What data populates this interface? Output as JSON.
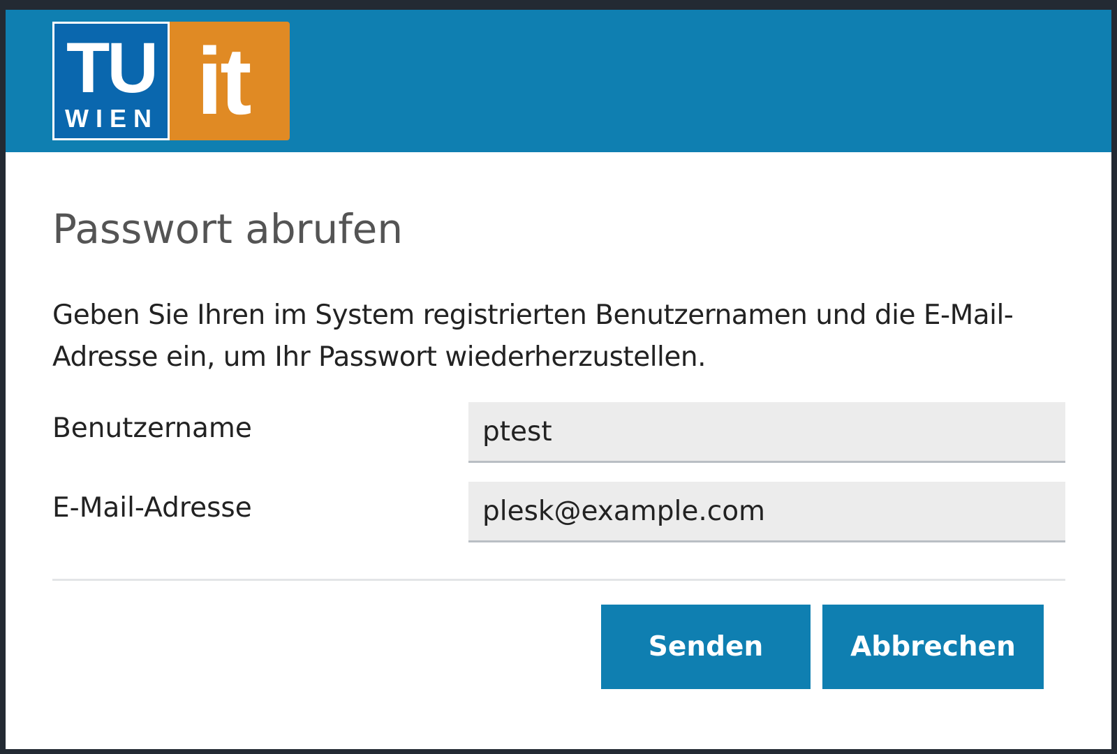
{
  "header": {
    "logo": {
      "tu_text": "TU",
      "wien_text": "WIEN",
      "it_text": "it",
      "tu_color": "#0a67ae",
      "it_color": "#e08a24"
    },
    "background_color": "#0f7fb1"
  },
  "dialog": {
    "title": "Passwort abrufen",
    "description": "Geben Sie Ihren im System registrierten Benutzernamen und die E-Mail-Adresse ein, um Ihr Passwort wiederherzustellen."
  },
  "form": {
    "username": {
      "label": "Benutzername",
      "value": "ptest"
    },
    "email": {
      "label": "E-Mail-Adresse",
      "value": "plesk@example.com"
    }
  },
  "buttons": {
    "send_label": "Senden",
    "cancel_label": "Abbrechen",
    "color": "#0f7fb1"
  }
}
